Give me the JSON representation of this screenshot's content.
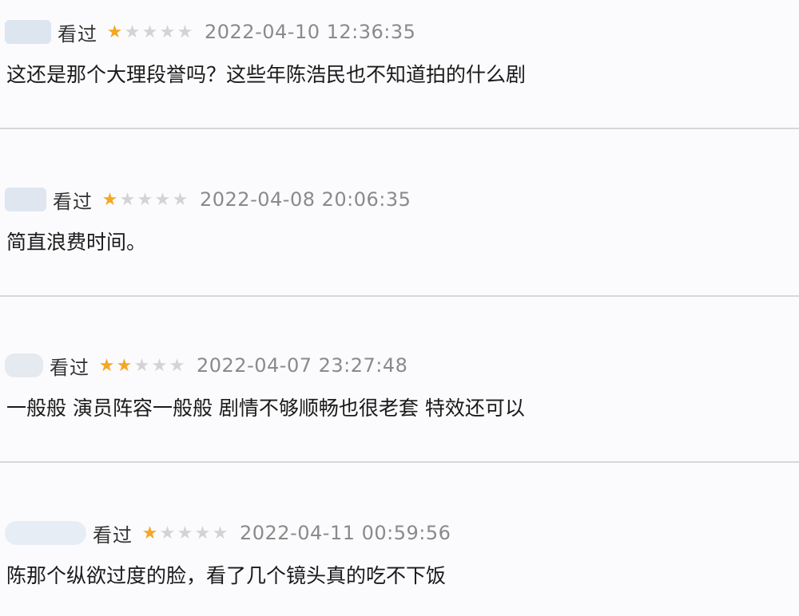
{
  "reviews": [
    {
      "watched_label": "看过",
      "rating": 1,
      "rating_max": 5,
      "time": "2022-04-10 12:36:35",
      "text": "这还是那个大理段誉吗？这些年陈浩民也不知道拍的什么剧"
    },
    {
      "watched_label": "看过",
      "rating": 1,
      "rating_max": 5,
      "time": "2022-04-08 20:06:35",
      "text": "简直浪费时间。"
    },
    {
      "watched_label": "看过",
      "rating": 2,
      "rating_max": 5,
      "time": "2022-04-07 23:27:48",
      "text": "一般般 演员阵容一般般 剧情不够顺畅也很老套 特效还可以"
    },
    {
      "watched_label": "看过",
      "rating": 1,
      "rating_max": 5,
      "time": "2022-04-11 00:59:56",
      "text": "陈那个纵欲过度的脸，看了几个镜头真的吃不下饭"
    }
  ],
  "icons": {
    "star_filled": "star-filled-icon",
    "star_empty": "star-empty-icon"
  },
  "colors": {
    "star_on": "#f5a623",
    "star_off": "#d3d3d3",
    "timestamp": "#8a8a8a",
    "divider": "#d6d6dc"
  }
}
